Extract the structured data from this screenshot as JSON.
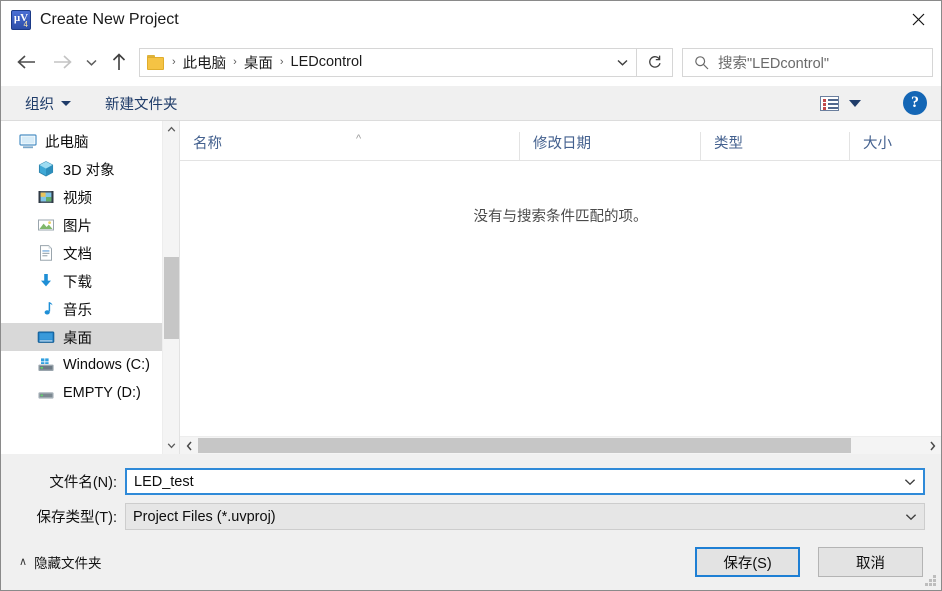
{
  "window": {
    "title": "Create New Project",
    "app_icon": "uvision-icon",
    "icon_glyph": "µV",
    "icon_sub": "4",
    "close_label": "✕",
    "accent_color": "#2f8ad8",
    "titlebar_bg": "#ffffff"
  },
  "nav": {
    "back_icon": "arrow-left-icon",
    "forward_icon": "arrow-right-icon",
    "recent_icon": "chevron-down-icon",
    "up_icon": "arrow-up-icon",
    "folder_icon": "folder-icon",
    "breadcrumbs": [
      {
        "label": "此电脑"
      },
      {
        "label": "桌面"
      },
      {
        "label": "LEDcontrol"
      }
    ],
    "separator": "›",
    "dropdown_icon": "chevron-down-icon",
    "refresh_icon": "refresh-icon"
  },
  "search": {
    "icon": "search-icon",
    "placeholder": "搜索\"LEDcontrol\""
  },
  "toolbar": {
    "organize_label": "组织",
    "new_folder_label": "新建文件夹",
    "view_mode_icon": "view-details-icon",
    "view_mode_caret_icon": "chevron-down-icon",
    "help_label": "?",
    "help_color": "#1466b5"
  },
  "sidebar": {
    "items": [
      {
        "label": "此电脑",
        "icon": "this-pc-icon",
        "indent": false,
        "selected": false
      },
      {
        "label": "3D 对象",
        "icon": "3d-objects-icon",
        "indent": true,
        "selected": false
      },
      {
        "label": "视频",
        "icon": "videos-icon",
        "indent": true,
        "selected": false
      },
      {
        "label": "图片",
        "icon": "pictures-icon",
        "indent": true,
        "selected": false
      },
      {
        "label": "文档",
        "icon": "documents-icon",
        "indent": true,
        "selected": false
      },
      {
        "label": "下载",
        "icon": "downloads-icon",
        "indent": true,
        "selected": false
      },
      {
        "label": "音乐",
        "icon": "music-icon",
        "indent": true,
        "selected": false
      },
      {
        "label": "桌面",
        "icon": "desktop-icon",
        "indent": true,
        "selected": true
      },
      {
        "label": "Windows  (C:)",
        "icon": "os-drive-icon",
        "indent": true,
        "selected": false
      },
      {
        "label": "EMPTY (D:)",
        "icon": "drive-icon",
        "indent": true,
        "selected": false
      }
    ],
    "scroll_up_icon": "chevron-up-icon",
    "scroll_down_icon": "chevron-down-icon"
  },
  "filelist": {
    "columns": [
      {
        "label": "名称",
        "sorted": "asc",
        "sort_icon": "caret-up-icon"
      },
      {
        "label": "修改日期",
        "sorted": ""
      },
      {
        "label": "类型",
        "sorted": ""
      },
      {
        "label": "大小",
        "sorted": ""
      }
    ],
    "rows": [],
    "empty_message": "没有与搜索条件匹配的项。",
    "hscroll_left_icon": "chevron-left-icon",
    "hscroll_right_icon": "chevron-right-icon"
  },
  "form": {
    "filename_label": "文件名(N):",
    "filename_value": "LED_test",
    "filename_focused": true,
    "filetype_label": "保存类型(T):",
    "filetype_value": "Project Files (*.uvproj)",
    "filetype_options": [
      "Project Files (*.uvproj)"
    ],
    "dropdown_icon": "chevron-down-icon"
  },
  "footer": {
    "hide_folders_label": "隐藏文件夹",
    "hide_folders_caret": "∧",
    "save_label": "保存(S)",
    "cancel_label": "取消",
    "resize_grip_icon": "resize-grip-icon"
  }
}
